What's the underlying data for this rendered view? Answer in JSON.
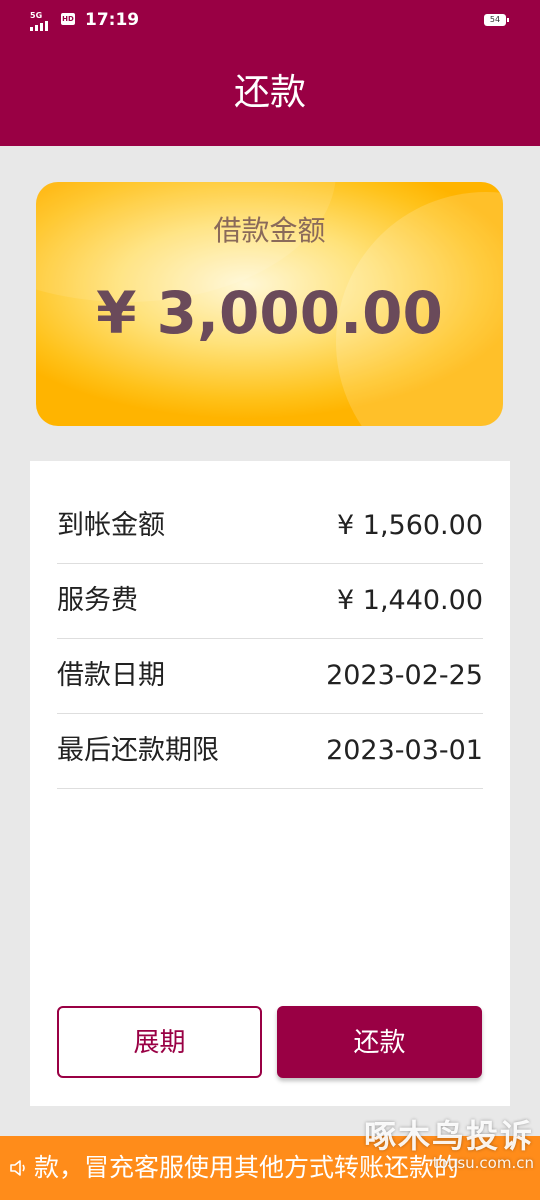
{
  "status_bar": {
    "network": "5G",
    "hd": "HD",
    "time": "17:19",
    "battery": "54"
  },
  "header": {
    "title": "还款"
  },
  "loan_card": {
    "label": "借款金额",
    "amount": "¥ 3,000.00"
  },
  "details": [
    {
      "label": "到帐金额",
      "value": "¥ 1,560.00"
    },
    {
      "label": "服务费",
      "value": "¥ 1,440.00"
    },
    {
      "label": "借款日期",
      "value": "2023-02-25"
    },
    {
      "label": "最后还款期限",
      "value": "2023-03-01"
    }
  ],
  "buttons": {
    "extend": "展期",
    "repay": "还款"
  },
  "notice": {
    "text": "款，冒充客服使用其他方式转账还款的"
  },
  "watermark": {
    "title": "啄木鸟投诉",
    "url": "tousu.com.cn"
  },
  "colors": {
    "brand": "#990044",
    "notice_bg": "#ff8c1a",
    "card_gold": "#ffc21a"
  }
}
